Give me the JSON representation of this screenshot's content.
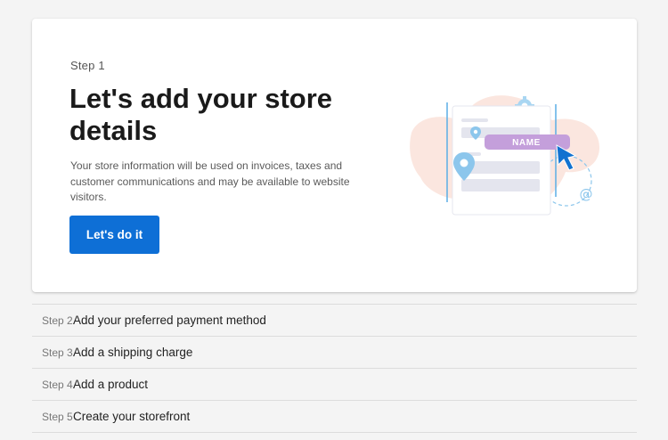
{
  "current_step": {
    "label": "Step 1",
    "title": "Let's add your store details",
    "description": "Your store information will be used on invoices, taxes and customer communications and may be available to website visitors.",
    "button_label": "Let's do it",
    "illustration_text": "NAME"
  },
  "upcoming_steps": [
    {
      "number": "Step 2",
      "title": "Add your preferred payment method"
    },
    {
      "number": "Step 3",
      "title": "Add a shipping charge"
    },
    {
      "number": "Step 4",
      "title": "Add a product"
    },
    {
      "number": "Step 5",
      "title": "Create your storefront"
    }
  ],
  "colors": {
    "accent": "#0e6fd6",
    "background": "#f4f4f4",
    "name_pill": "#c49fdb"
  },
  "icons": [
    "location-pin-icon",
    "gear-icon",
    "at-sign-icon",
    "cursor-arrow-icon"
  ]
}
